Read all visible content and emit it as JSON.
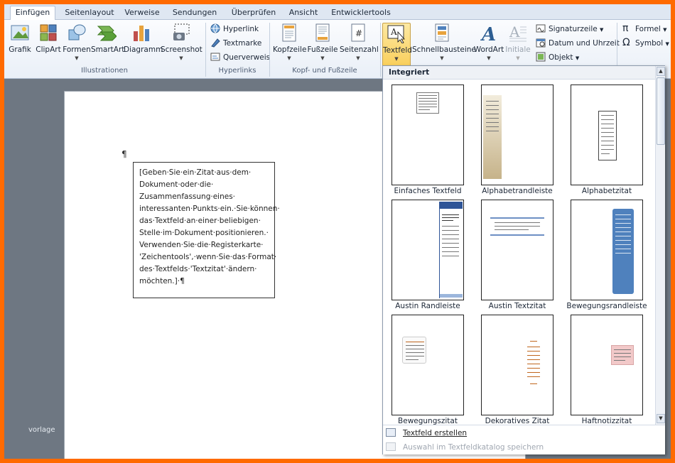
{
  "tabs": [
    {
      "label": "Einfügen",
      "active": true
    },
    {
      "label": "Seitenlayout"
    },
    {
      "label": "Verweise"
    },
    {
      "label": "Sendungen"
    },
    {
      "label": "Überprüfen"
    },
    {
      "label": "Ansicht"
    },
    {
      "label": "Entwicklertools"
    }
  ],
  "ribbon": {
    "illustrationen": {
      "label": "Illustrationen",
      "buttons": [
        "Grafik",
        "ClipArt",
        "Formen",
        "SmartArt",
        "Diagramm",
        "Screenshot"
      ]
    },
    "hyperlinks": {
      "label": "Hyperlinks",
      "items": [
        "Hyperlink",
        "Textmarke",
        "Querverweis"
      ]
    },
    "kopf": {
      "label": "Kopf- und Fußzeile",
      "buttons": [
        "Kopfzeile",
        "Fußzeile",
        "Seitenzahl"
      ]
    },
    "text": {
      "buttons": [
        "Textfeld",
        "Schnellbausteine",
        "WordArt",
        "Initiale"
      ],
      "items": [
        "Signaturzeile",
        "Datum und Uhrzeit",
        "Objekt"
      ]
    },
    "symbole": {
      "items": [
        "Formel",
        "Symbol"
      ]
    }
  },
  "document": {
    "textbox_lines": [
      "[Geben·Sie·ein·Zitat·aus·dem·",
      "Dokument·oder·die·",
      "Zusammenfassung·eines·",
      "interessanten·Punkts·ein.·Sie·können·",
      "das·Textfeld·an·einer·beliebigen·",
      "Stelle·im·Dokument·positionieren.·",
      "Verwenden·Sie·die·Registerkarte·",
      "'Zeichentools',·wenn·Sie·das·Format·",
      "des·Textfelds·'Textzitat'·ändern·",
      "möchten.]·¶"
    ],
    "para_mark": "¶",
    "side_label": "vorlage"
  },
  "gallery": {
    "header": "Integriert",
    "items": [
      "Einfaches Textfeld",
      "Alphabetrandleiste",
      "Alphabetzitat",
      "Austin Randleiste",
      "Austin Textzitat",
      "Bewegungsrandleiste",
      "Bewegungszitat",
      "Dekoratives Zitat",
      "Haftnotizzitat"
    ],
    "footer": {
      "create": "Textfeld erstellen",
      "save": "Auswahl im Textfeldkatalog speichern"
    }
  },
  "colors": {
    "frame_border": "#ff6a00",
    "ribbon_pressed": "#f9cf5b",
    "austin_blue": "#2f5597",
    "bewegung_blue": "#4f81bd",
    "dekorativ_orange": "#c0661e",
    "haftnotiz_pink": "#f2c9c9"
  }
}
